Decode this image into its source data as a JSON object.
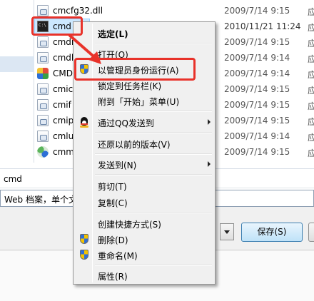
{
  "file_list": {
    "rows": [
      {
        "icon": "dll-file-icon",
        "name": "cmcfg32.dll",
        "date": "2009/7/14 9:15",
        "type": "应"
      },
      {
        "icon": "cmd-app-icon",
        "name": "cmd",
        "date": "2010/11/21 11:24",
        "type": "应",
        "selected": true
      },
      {
        "icon": "dll-file-icon",
        "name": "cmdi",
        "date": "2009/7/14 9:15",
        "type": "应"
      },
      {
        "icon": "dll-file-icon",
        "name": "cmdl",
        "date": "2009/7/14 9:14",
        "type": "应"
      },
      {
        "icon": "color-app-icon",
        "name": "CMD",
        "date": "2009/7/14 9:14",
        "type": "应"
      },
      {
        "icon": "dll-file-icon",
        "name": "cmic",
        "date": "2009/7/14 9:15",
        "type": "应"
      },
      {
        "icon": "dll-file-icon",
        "name": "cmif",
        "date": "2009/7/14 9:15",
        "type": "应"
      },
      {
        "icon": "dll-file-icon",
        "name": "cmip",
        "date": "2009/7/14 9:15",
        "type": "应"
      },
      {
        "icon": "dll-file-icon",
        "name": "cmlu",
        "date": "2009/7/14 9:14",
        "type": "应"
      },
      {
        "icon": "cmmgr-app-icon",
        "name": "cmm",
        "date": "2009/7/14 9:15",
        "type": "应"
      }
    ]
  },
  "filename_field": {
    "value": "cmd"
  },
  "type_field": {
    "value": "Web 档案，单个文"
  },
  "buttons": {
    "save_label": "保存(S)"
  },
  "context_menu": {
    "items": [
      {
        "label": "选定(L)",
        "bold": true
      },
      {
        "label": "打开(O)"
      },
      {
        "label": "以管理员身份运行(A)",
        "icon": "uac-shield-icon"
      },
      {
        "label": "锁定到任务栏(K)"
      },
      {
        "label": "附到「开始」菜单(U)"
      },
      {
        "label": "通过QQ发送到",
        "icon": "qq-icon",
        "submenu": true
      },
      {
        "label": "还原以前的版本(V)"
      },
      {
        "label": "发送到(N)",
        "submenu": true
      },
      {
        "label": "剪切(T)"
      },
      {
        "label": "复制(C)"
      },
      {
        "label": "创建快捷方式(S)"
      },
      {
        "label": "删除(D)",
        "icon": "uac-shield-icon"
      },
      {
        "label": "重命名(M)",
        "icon": "uac-shield-icon"
      },
      {
        "label": "属性(R)"
      }
    ]
  },
  "colors": {
    "annotation": "#e8322a",
    "selection": "#cce8ff",
    "menu_bg": "#f0f0f0"
  }
}
